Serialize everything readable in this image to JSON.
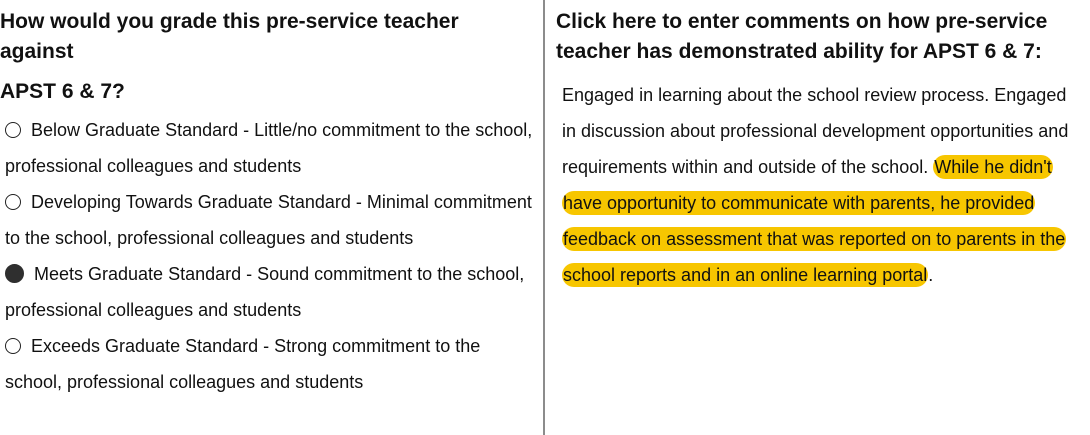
{
  "question": {
    "title_line1": "How would you grade this pre-service teacher",
    "title_line2": "against",
    "subtitle": "APST 6 & 7?"
  },
  "options": [
    {
      "label": "Below Graduate Standard - Little/no commitment to the school, professional colleagues and students",
      "selected": false
    },
    {
      "label": "Developing Towards Graduate Standard - Minimal commitment to the school, professional colleagues and students",
      "selected": false
    },
    {
      "label": "Meets Graduate Standard - Sound commitment to the school, professional colleagues and students",
      "selected": true
    },
    {
      "label": "Exceeds Graduate Standard - Strong commitment to the school, professional colleagues and students",
      "selected": false
    }
  ],
  "comments": {
    "heading_line1": "Click here to enter comments on how pre-service",
    "heading_line2": "teacher has demonstrated ability for APST 6 & 7:",
    "text_plain": "Engaged in learning about the school review process. Engaged in discussion about professional development opportunities and requirements within and outside of the school.",
    "text_highlighted": "While he didn't have opportunity to communicate with parents, he provided feedback on assessment that was reported on to parents in the school reports and in an online learning portal",
    "text_end": ".",
    "highlight_color": "#f7c600"
  }
}
